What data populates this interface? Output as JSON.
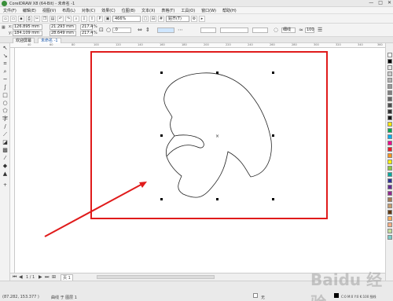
{
  "titlebar": {
    "title": "CorelDRAW X8 (64-Bit) - 未命名 -1",
    "min": "—",
    "max": "□",
    "close": "✕"
  },
  "menu": [
    "文件(F)",
    "编辑(E)",
    "视图(V)",
    "布局(L)",
    "对象(C)",
    "效果(C)",
    "位图(B)",
    "文本(X)",
    "表格(T)",
    "工具(O)",
    "窗口(W)",
    "帮助(H)"
  ],
  "toolbar1": {
    "zoom": "466%",
    "snap": "贴齐(T)"
  },
  "props": {
    "x": "126.895 mm",
    "y": "184.109 mm",
    "w": "21.293 mm",
    "h": "28.649 mm",
    "sx": "217.4",
    "sy": "217.4",
    "pct": "%",
    "angle": ".0",
    "outline": "细线",
    "smooth": "100"
  },
  "tabs": [
    "欢迎屏幕",
    "未命名 -1"
  ],
  "ruler_ticks": [
    "40",
    "60",
    "80",
    "100",
    "120",
    "140",
    "160",
    "180",
    "200",
    "220",
    "240",
    "260",
    "280",
    "300",
    "320",
    "340",
    "360"
  ],
  "pagebar": {
    "page_info": "1 / 1",
    "page_tab": "页 1"
  },
  "status": {
    "coords": "(87.282, 153.377 )",
    "info": "曲线 于 图层 1",
    "fill": "无",
    "outline": "C:0 M:0 Y:0 K:100 细线"
  },
  "palette": [
    "#ffffff",
    "#000000",
    "#e6e6e6",
    "#cccccc",
    "#b3b3b3",
    "#999999",
    "#808080",
    "#666666",
    "#4d4d4d",
    "#333333",
    "#1a1a1a",
    "#ffe600",
    "#00a651",
    "#00aeef",
    "#ec008c",
    "#ed1c24",
    "#f7941d",
    "#fff200",
    "#8dc63f",
    "#00a99d",
    "#2e3192",
    "#662d91",
    "#92278f",
    "#a67c52",
    "#c69c6d",
    "#603913",
    "#fbaf5d",
    "#f9ad81",
    "#c4df9b",
    "#7accc8"
  ],
  "watermark": "Baidu 经验"
}
